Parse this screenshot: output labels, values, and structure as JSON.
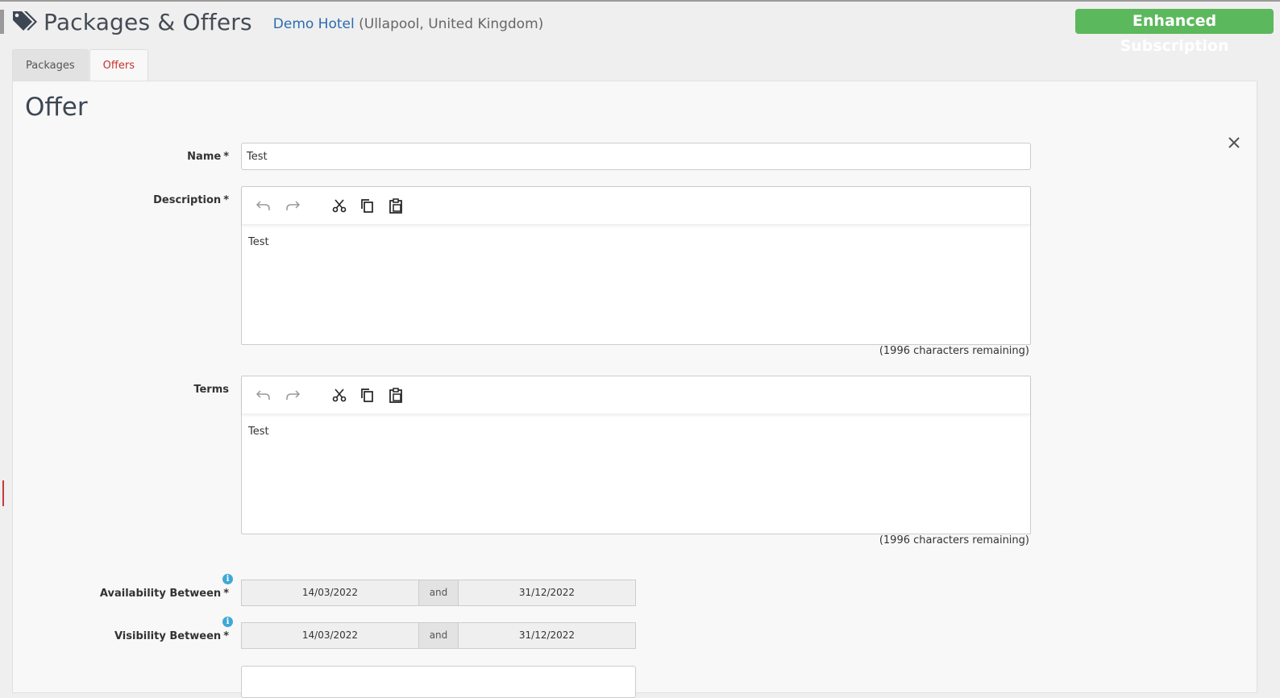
{
  "header": {
    "title": "Packages & Offers",
    "hotel_name": "Demo Hotel",
    "hotel_location": "(Ullapool, United Kingdom)",
    "subscription_badge": "Enhanced Subscription",
    "icon": "tags-icon"
  },
  "tabs": [
    {
      "label": "Packages",
      "active": false
    },
    {
      "label": "Offers",
      "active": true
    }
  ],
  "form": {
    "heading": "Offer",
    "name": {
      "label": "Name",
      "required_mark": "*",
      "value": "Test"
    },
    "description": {
      "label": "Description",
      "required_mark": "*",
      "content": "Test",
      "remaining": "(1996 characters remaining)"
    },
    "terms": {
      "label": "Terms",
      "content": "Test",
      "remaining": "(1996 characters remaining)"
    },
    "availability": {
      "label": "Availability Between",
      "required_mark": "*",
      "from": "14/03/2022",
      "and": "and",
      "to": "31/12/2022"
    },
    "visibility": {
      "label": "Visibility Between",
      "required_mark": "*",
      "from": "14/03/2022",
      "and": "and",
      "to": "31/12/2022"
    },
    "info_icon": "i"
  },
  "toolbar_icons": [
    "undo-icon",
    "redo-icon",
    "cut-icon",
    "copy-icon",
    "paste-icon"
  ],
  "colors": {
    "accent_green": "#5cb85c",
    "link_blue": "#2b6cb0",
    "active_tab_red": "#c9302c",
    "info_blue": "#3fa9d6"
  }
}
